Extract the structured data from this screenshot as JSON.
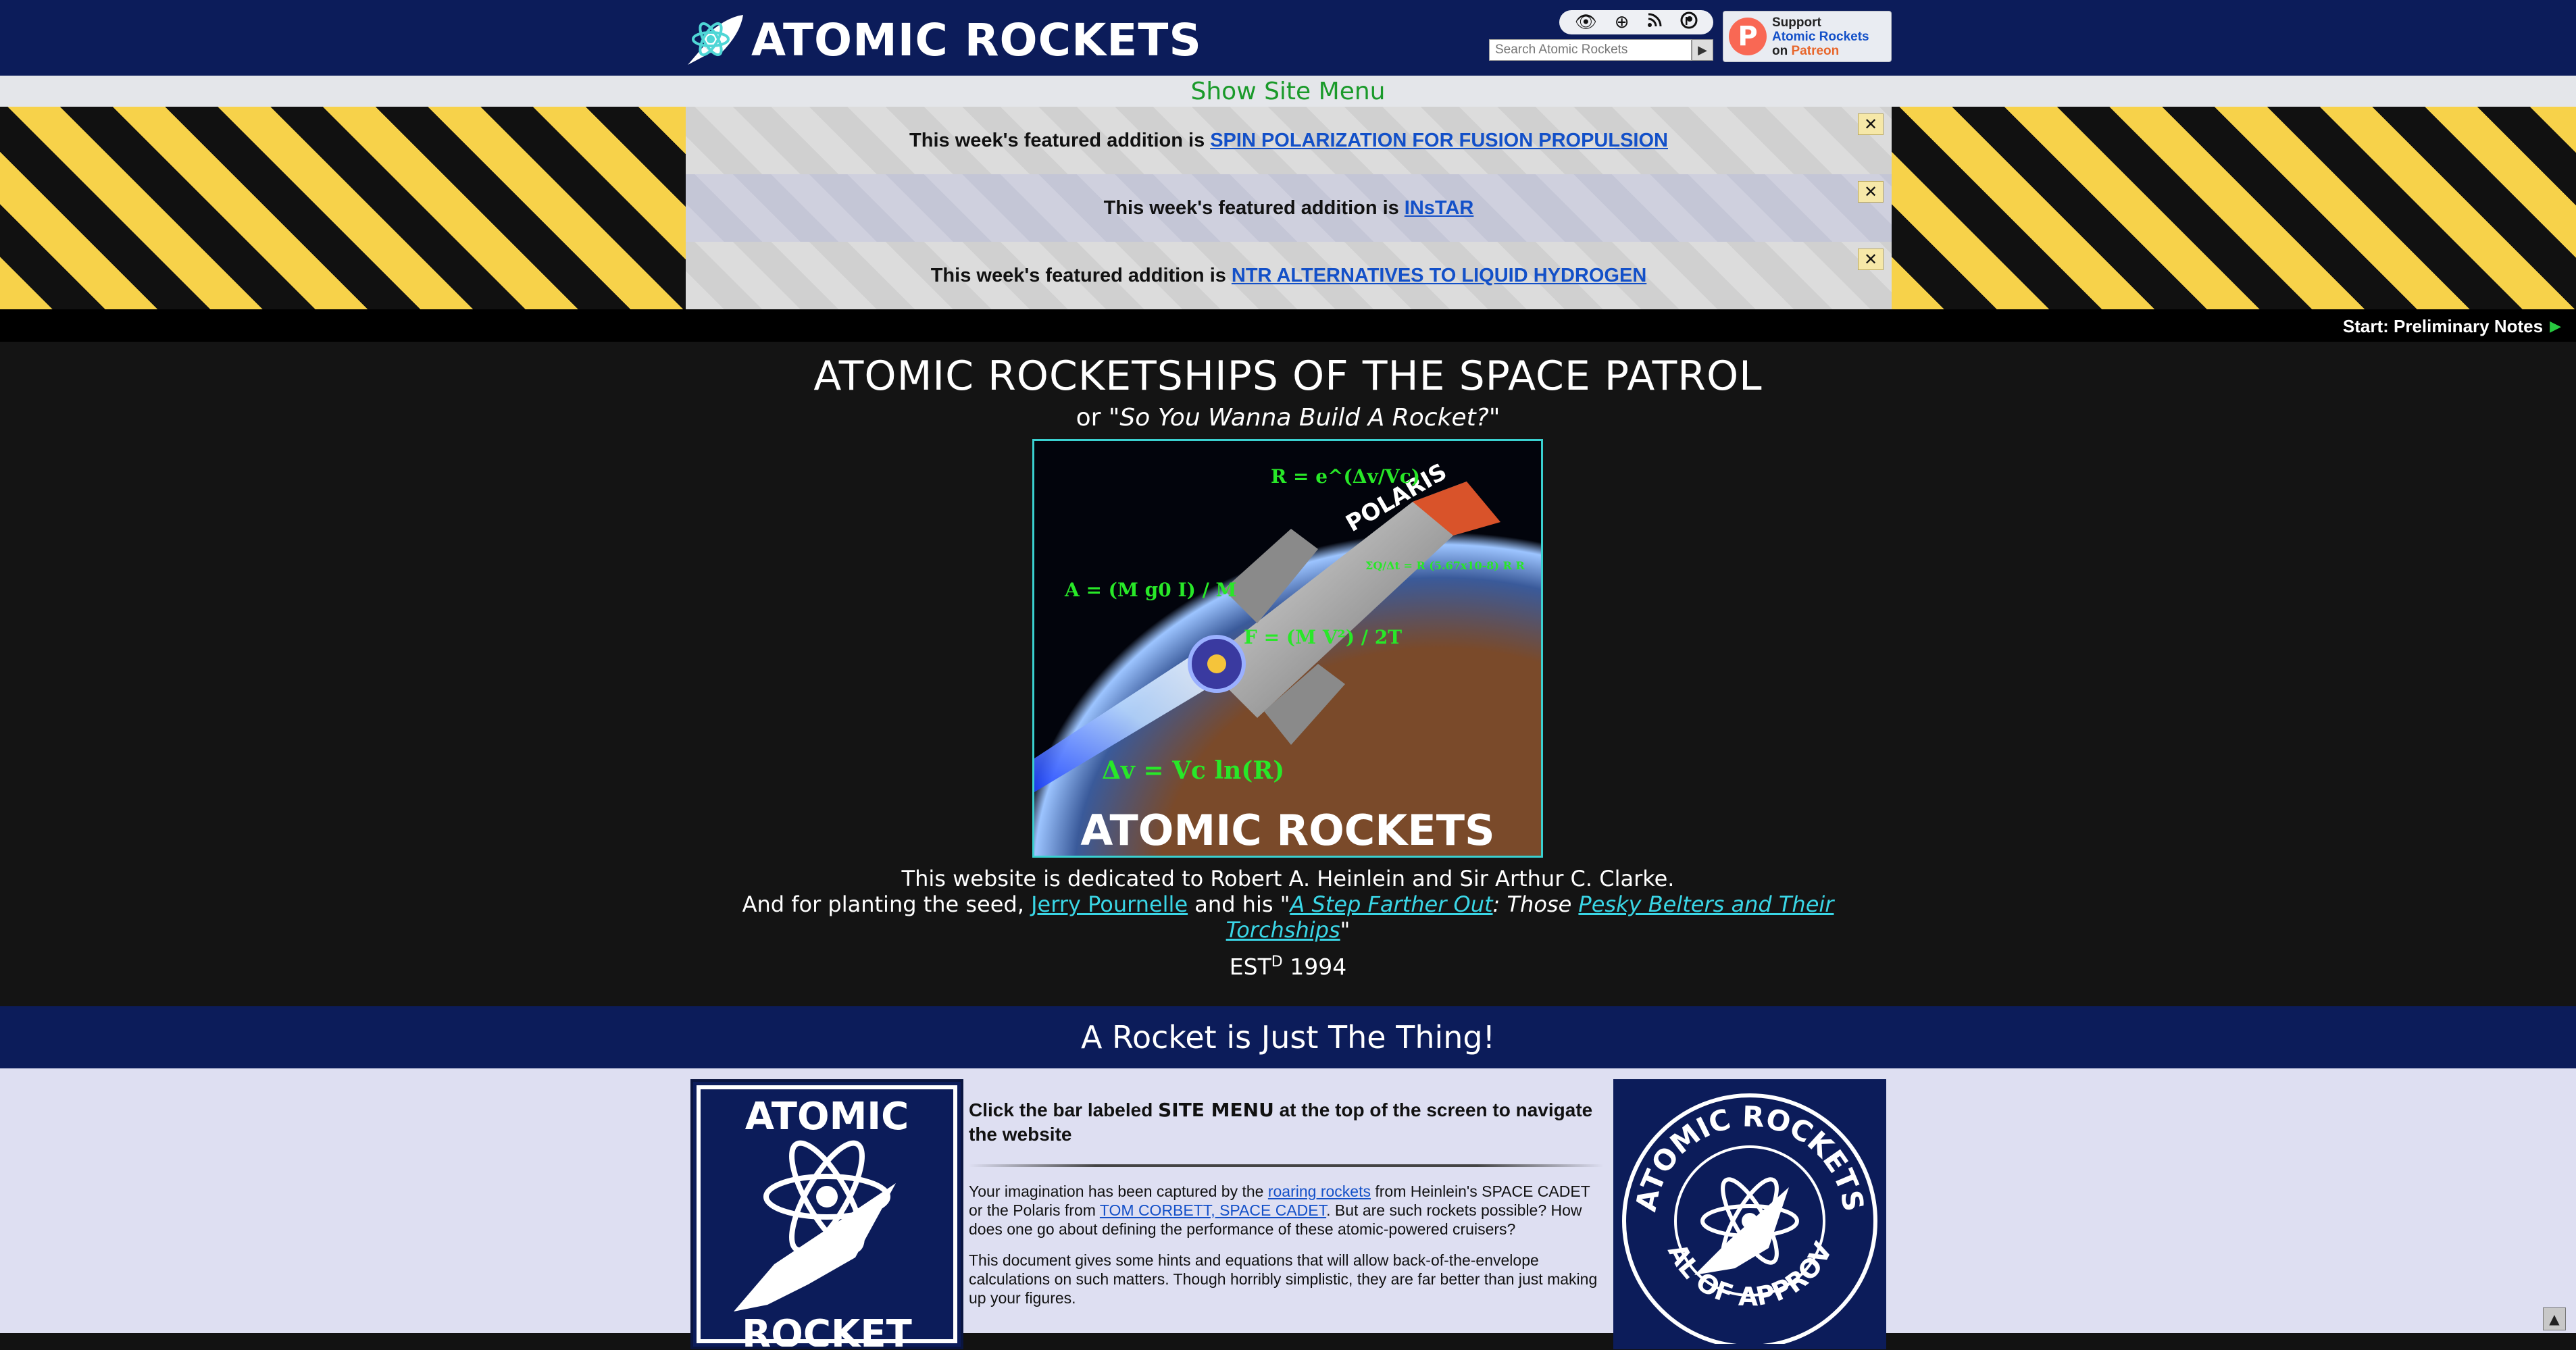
{
  "header": {
    "logo_text": "ATOMIC ROCKETS",
    "toolbar_icons": [
      "eye-icon",
      "crosshair-icon",
      "rss-icon",
      "patreon-icon"
    ],
    "search_placeholder": "Search Atomic Rockets",
    "search_go": "▶",
    "patreon": {
      "line1": "Support",
      "line2": "Atomic Rockets",
      "line3_prefix": "on ",
      "line3_brand": "Patreon"
    }
  },
  "site_menu": {
    "label": "Show Site Menu"
  },
  "featured": {
    "prefix": "This week's featured addition is",
    "items": [
      {
        "link": "SPIN POLARIZATION FOR FUSION PROPULSION"
      },
      {
        "link": "INsTAR"
      },
      {
        "link": "NTR ALTERNATIVES TO LIQUID HYDROGEN"
      }
    ],
    "close": "✕"
  },
  "start_bar": {
    "label": "Start: Preliminary Notes",
    "arrow": "▶"
  },
  "intro": {
    "title": "ATOMIC ROCKETSHIPS OF THE SPACE PATROL",
    "subtitle_prefix": "or ",
    "subtitle_quote": "\"So You Wanna Build A Rocket?\"",
    "hero": {
      "equations": [
        "R = e^(Δv/Vc)",
        "A = (M g0 I) / M",
        "F = (M V²) / 2T",
        "Δv = Vc ln(R)",
        "ΣQ/Δt = R (5.67x10-8) R R"
      ],
      "caption": "ATOMIC ROCKETS",
      "hull_text": "POLARIS"
    },
    "dedication_line1": "This website is dedicated to Robert A. Heinlein and Sir Arthur C. Clarke.",
    "dedication_line2_prefix": "And for planting the seed, ",
    "dedication_link1": "Jerry Pournelle",
    "dedication_mid": " and his \"",
    "dedication_link2": "A Step Farther Out",
    "dedication_mid2": ": Those ",
    "dedication_link3": "Pesky Belters and Their Torchships",
    "dedication_end": "\"",
    "est_prefix": "EST",
    "est_sup": "D",
    "est_year": " 1994"
  },
  "section": {
    "title": "A Rocket is Just The Thing!"
  },
  "content": {
    "heading_prefix": "Click the bar labeled ",
    "heading_strong": "SITE MENU",
    "heading_suffix": " at the top of the screen to navigate the website",
    "p1_a": "Your imagination has been captured by the ",
    "p1_link1": "roaring rockets",
    "p1_b": " from Heinlein's SPACE CADET or the Polaris from ",
    "p1_link2": "TOM CORBETT, SPACE CADET",
    "p1_c": ". But are such rockets possible? How does one go about defining the performance of these atomic-powered cruisers?",
    "p2": "This document gives some hints and equations that will allow back-of-the-envelope calculations on such matters. Though horribly simplistic, they are far better than just making up your figures."
  },
  "left_badge": {
    "top": "ATOMIC",
    "bottom": "ROCKET"
  },
  "right_badge": {
    "ring_top": "ATOMIC ROCKETS",
    "ring_bottom": "SEAL OF APPROVAL"
  },
  "scroll_top": "▲"
}
